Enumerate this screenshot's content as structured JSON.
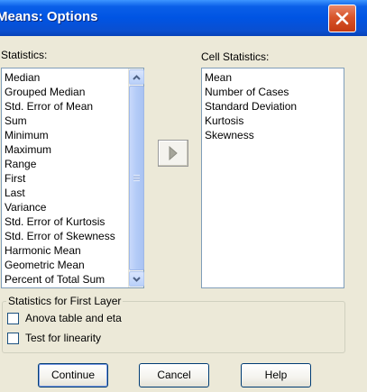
{
  "window": {
    "title": "Means: Options",
    "close_label": "Close"
  },
  "statistics": {
    "label": "Statistics:",
    "items": [
      "Median",
      "Grouped Median",
      "Std. Error of Mean",
      "Sum",
      "Minimum",
      "Maximum",
      "Range",
      "First",
      "Last",
      "Variance",
      "Std. Error of Kurtosis",
      "Std. Error of Skewness",
      "Harmonic Mean",
      "Geometric Mean",
      "Percent of Total Sum"
    ]
  },
  "move_button": {
    "icon": "right-arrow-icon"
  },
  "cell_statistics": {
    "label": "Cell Statistics:",
    "items": [
      "Mean",
      "Number of Cases",
      "Standard Deviation",
      "Kurtosis",
      "Skewness"
    ]
  },
  "first_layer": {
    "legend": "Statistics for First Layer",
    "anova_label": "Anova table and eta",
    "anova_checked": false,
    "linearity_label": "Test for linearity",
    "linearity_checked": false
  },
  "buttons": {
    "continue": "Continue",
    "cancel": "Cancel",
    "help": "Help"
  },
  "colors": {
    "titlebar": "#0054e3",
    "close_button": "#d8552b",
    "dialog_bg": "#ece9d8"
  }
}
